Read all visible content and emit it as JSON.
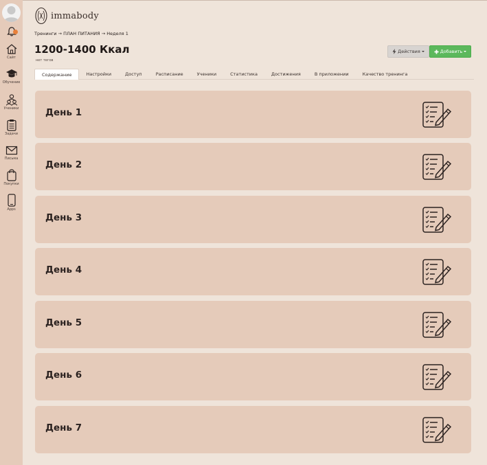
{
  "sidebar": {
    "items": [
      {
        "label": "Сайт",
        "icon": "home-icon"
      },
      {
        "label": "Обучение",
        "icon": "graduation-cap-icon"
      },
      {
        "label": "Ученики",
        "icon": "students-icon"
      },
      {
        "label": "Задачи",
        "icon": "clipboard-icon"
      },
      {
        "label": "Письма",
        "icon": "envelope-icon"
      },
      {
        "label": "Покупки",
        "icon": "shopping-bag-icon"
      },
      {
        "label": "Apps",
        "icon": "mobile-phone-icon"
      }
    ]
  },
  "logo": {
    "text": "immabody"
  },
  "breadcrumb": {
    "item1": "Тренинги",
    "sep": " → ",
    "item2": "ПЛАН ПИТАНИЯ",
    "item3": "Неделя 1"
  },
  "page": {
    "title": "1200-1400 Ккал",
    "tags": "нет тегов"
  },
  "buttons": {
    "actions": "Действия",
    "add": "Добавить"
  },
  "tabs": [
    {
      "label": "Содержание",
      "active": true
    },
    {
      "label": "Настройки"
    },
    {
      "label": "Доступ"
    },
    {
      "label": "Расписание"
    },
    {
      "label": "Ученики"
    },
    {
      "label": "Статистика"
    },
    {
      "label": "Достижения"
    },
    {
      "label": "В приложении"
    },
    {
      "label": "Качество тренинга"
    }
  ],
  "days": [
    {
      "title": "День 1"
    },
    {
      "title": "День 2"
    },
    {
      "title": "День 3"
    },
    {
      "title": "День 4"
    },
    {
      "title": "День 5"
    },
    {
      "title": "День 6"
    },
    {
      "title": "День 7"
    }
  ],
  "colors": {
    "background": "#efe4da",
    "sidebar": "#e5cbba",
    "card": "#e5cbba",
    "add_button": "#5cb85c",
    "notification": "#e8803a"
  }
}
